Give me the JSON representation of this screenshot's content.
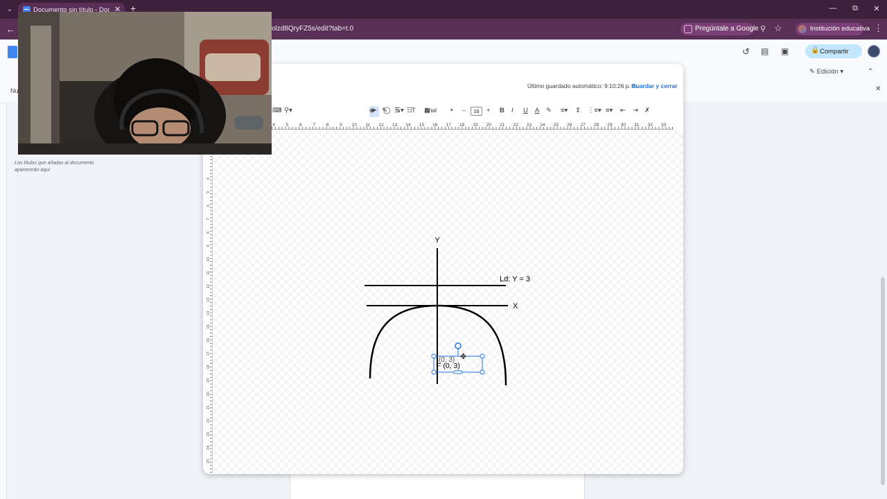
{
  "browser": {
    "tab_title": "Documento sin título - Docume",
    "url_partial": "olzd8QryFZ5s/edit?tab=t.0",
    "ask_google": "Pregúntale a Google",
    "profile_label": "Institución educativa"
  },
  "docs": {
    "share_label": "Compartir",
    "edit_mode": "Edición",
    "sidebar_partial": "Nue",
    "outline_hint": "Los títulos que añadas al documento aparecerán aquí"
  },
  "drawing": {
    "autosave": "Último guardado automático: 9:10:26 p. m.",
    "save_close": "Guardar y cerrar",
    "font_name": "Arial",
    "font_size": "16",
    "ruler_ticks": [
      "4",
      "5",
      "6",
      "7",
      "8",
      "9",
      "10",
      "11",
      "12",
      "13",
      "14",
      "15",
      "16",
      "17",
      "18",
      "19",
      "20",
      "21",
      "22",
      "23",
      "24",
      "25",
      "26",
      "27",
      "28",
      "29",
      "30",
      "31",
      "32",
      "33"
    ],
    "vruler_ticks": [
      "4",
      "5",
      "6",
      "7",
      "8",
      "9",
      "10",
      "11",
      "12",
      "13",
      "14",
      "15",
      "16",
      "17",
      "18",
      "19",
      "20",
      "21",
      "22",
      "23",
      "24",
      "25"
    ],
    "y_axis_label": "Y",
    "x_axis_label": "X",
    "directrix_label": "Ld: Y = 3",
    "focus_label": "F (0, 3)",
    "focus_ghost": "(0, 3)"
  }
}
